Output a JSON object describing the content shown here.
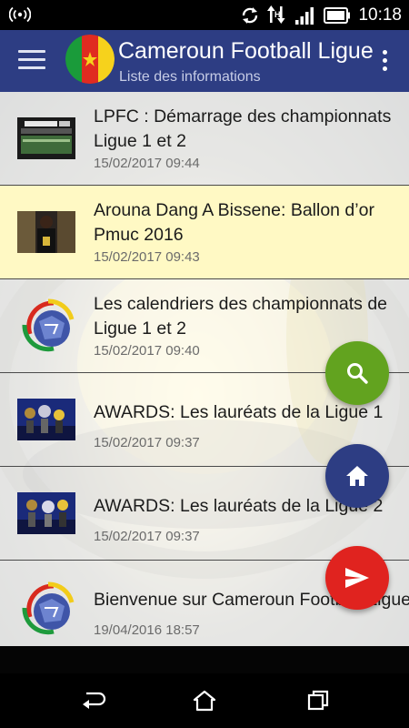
{
  "status_bar": {
    "time": "10:18",
    "icons": [
      "wireless-signal-icon",
      "sync-icon",
      "data-arrows-icon",
      "cell-signal-icon",
      "battery-icon"
    ]
  },
  "app_bar": {
    "title": "Cameroun Football Ligue",
    "subtitle": "Liste des informations",
    "color": "#2d3d83"
  },
  "news": [
    {
      "title": "LPFC : Démarrage des championnats Ligue 1 et 2",
      "date": "15/02/2017 09:44",
      "thumb": "stadium-photo"
    },
    {
      "title": "Arouna Dang A Bissene: Ballon d’or Pmuc 2016",
      "date": "15/02/2017 09:43",
      "thumb": "award-photo"
    },
    {
      "title": "Les calendriers des championnats de Ligue 1 et 2",
      "date": "15/02/2017 09:40",
      "thumb": "league-logo"
    },
    {
      "title": "AWARDS: Les lauréats de la Ligue 1",
      "date": "15/02/2017 09:37",
      "thumb": "awards-photo"
    },
    {
      "title": "AWARDS: Les lauréats de la Ligue 2",
      "date": "15/02/2017 09:37",
      "thumb": "awards-photo"
    },
    {
      "title": "Bienvenue sur Cameroun Football Ligue",
      "date": "19/04/2016 18:57",
      "thumb": "league-logo"
    }
  ],
  "fabs": [
    {
      "icon": "search-icon",
      "color": "#62a31f"
    },
    {
      "icon": "home-icon",
      "color": "#2d3d83"
    },
    {
      "icon": "send-icon",
      "color": "#e0231f"
    }
  ],
  "nav_bar": {
    "icons": [
      "back-icon",
      "home-nav-icon",
      "recent-apps-icon"
    ]
  }
}
